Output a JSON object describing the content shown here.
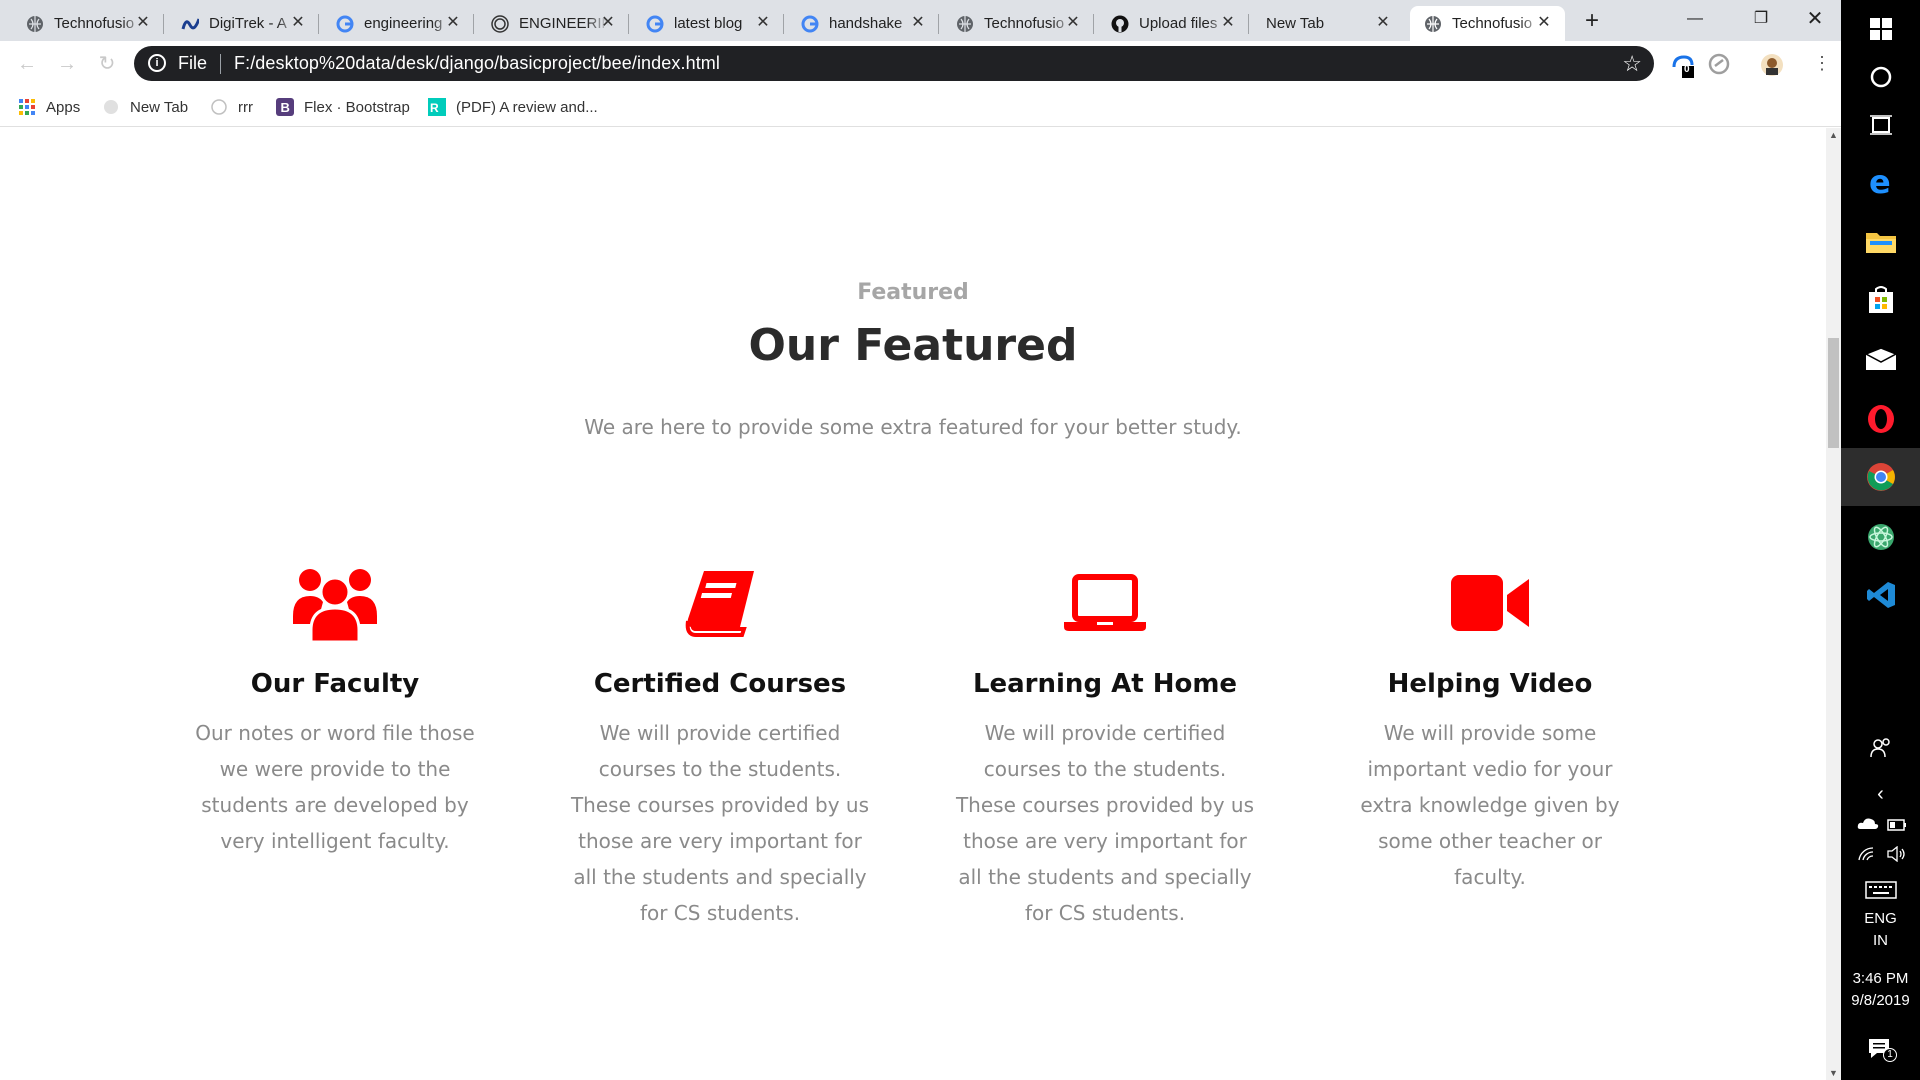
{
  "tabs": [
    {
      "title": "Technofusio",
      "icon": "globe-icon"
    },
    {
      "title": "DigiTrek - A",
      "icon": "digitrek-icon"
    },
    {
      "title": "engineering",
      "icon": "google-icon"
    },
    {
      "title": "ENGINEERING",
      "icon": "wordpress-icon"
    },
    {
      "title": "latest blog",
      "icon": "google-icon"
    },
    {
      "title": "handshake",
      "icon": "google-icon"
    },
    {
      "title": "Technofusio",
      "icon": "globe-icon"
    },
    {
      "title": "Upload files",
      "icon": "github-icon"
    },
    {
      "title": "New Tab",
      "icon": ""
    },
    {
      "title": "Technofusio",
      "icon": "globe-icon"
    }
  ],
  "omnibox": {
    "scheme": "File",
    "url": "F:/desktop%20data/desk/django/basicproject/bee/index.html"
  },
  "extensions": {
    "badge": "0"
  },
  "bookmarks": [
    {
      "label": "Apps",
      "icon": "apps-grid-icon"
    },
    {
      "label": "New Tab",
      "icon": "globe-icon"
    },
    {
      "label": "rrr",
      "icon": "globe-icon"
    },
    {
      "label": "Flex · Bootstrap",
      "icon": "bootstrap-icon"
    },
    {
      "label": "(PDF) A review and...",
      "icon": "researchgate-icon"
    }
  ],
  "section": {
    "kicker": "Featured",
    "heading": "Our Featured",
    "subtitle": "We are here to provide some extra featured for your better study."
  },
  "features": [
    {
      "title": "Our Faculty",
      "icon": "users-icon",
      "text": "Our notes or word file those we were provide to the students are developed by very intelligent faculty."
    },
    {
      "title": "Certified Courses",
      "icon": "book-icon",
      "text": "We will provide certified courses to the students. These courses provided by us those are very important for all the students and specially for CS students."
    },
    {
      "title": "Learning At Home",
      "icon": "laptop-icon",
      "text": "We will provide certified courses to the students. These courses provided by us those are very important for all the students and specially for CS students."
    },
    {
      "title": "Helping Video",
      "icon": "video-camera-icon",
      "text": "We will provide some important vedio for your extra knowledge given by some other teacher or faculty."
    }
  ],
  "colors": {
    "accent": "#ff0000",
    "heading": "#2b2b2b",
    "muted": "#8a8a8a"
  },
  "taskbar": {
    "lang_line1": "ENG",
    "lang_line2": "IN",
    "time": "3:46 PM",
    "date": "9/8/2019",
    "notification_count": "1"
  }
}
